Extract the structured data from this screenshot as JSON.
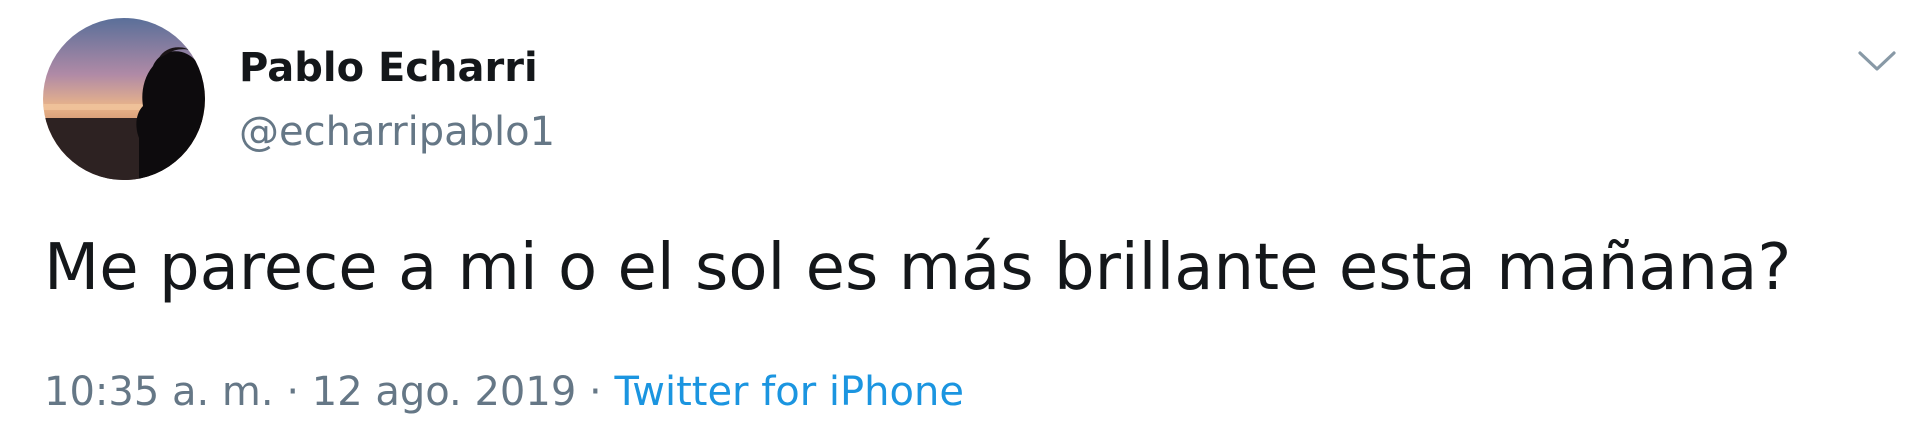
{
  "tweet": {
    "author_name": "Pablo Echarri",
    "author_handle": "@echarripablo1",
    "text": "Me parece a mi o el sol es más brillante esta mañana?",
    "time": "10:35 a. m.",
    "separator": "·",
    "date": "12 ago. 2019",
    "source": "Twitter for iPhone"
  },
  "icons": {
    "avatar": "profile-photo-sunset-silhouette",
    "menu": "chevron-down-icon"
  },
  "colors": {
    "name": "#14171a",
    "secondary_text": "#657786",
    "link": "#1b95e0",
    "background": "#ffffff"
  }
}
